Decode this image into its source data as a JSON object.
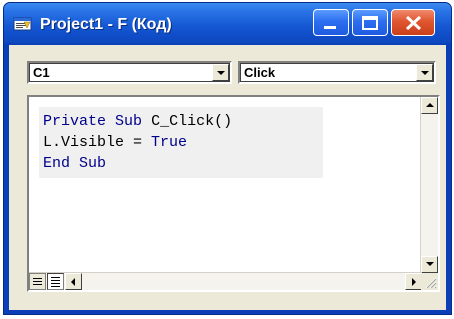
{
  "window": {
    "title": "Project1 - F (Код)",
    "icons": {
      "app_icon": "vb-code-window-icon",
      "minimize": "minimize-icon",
      "maximize": "maximize-icon",
      "close": "close-icon"
    }
  },
  "object_combo": {
    "selected": "C1"
  },
  "procedure_combo": {
    "selected": "Click"
  },
  "code": {
    "line1_kw1": "Private",
    "line1_kw2": "Sub",
    "line1_rest": "C_Click()",
    "line2_pre": "L.Visible = ",
    "line2_kw": "True",
    "line3_kw1": "End",
    "line3_kw2": "Sub"
  },
  "colors": {
    "keyword": "#00008b",
    "titlebar": "#0f4bc6",
    "close_button": "#e0562f"
  }
}
